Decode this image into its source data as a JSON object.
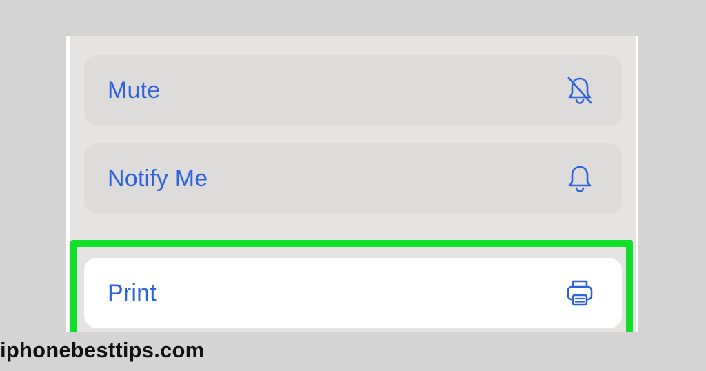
{
  "menu": {
    "items": [
      {
        "label": "Mute",
        "icon": "bell-slash-icon"
      },
      {
        "label": "Notify Me",
        "icon": "bell-icon"
      },
      {
        "label": "Print",
        "icon": "printer-icon"
      }
    ]
  },
  "highlight": {
    "target_index": 2
  },
  "watermark": "iphonebesttips.com",
  "colors": {
    "accent": "#2e63e0",
    "highlight": "#11e02a",
    "page_bg": "#d4d4d4",
    "card_muted": "#dedbdb",
    "card_white": "#ffffff"
  }
}
